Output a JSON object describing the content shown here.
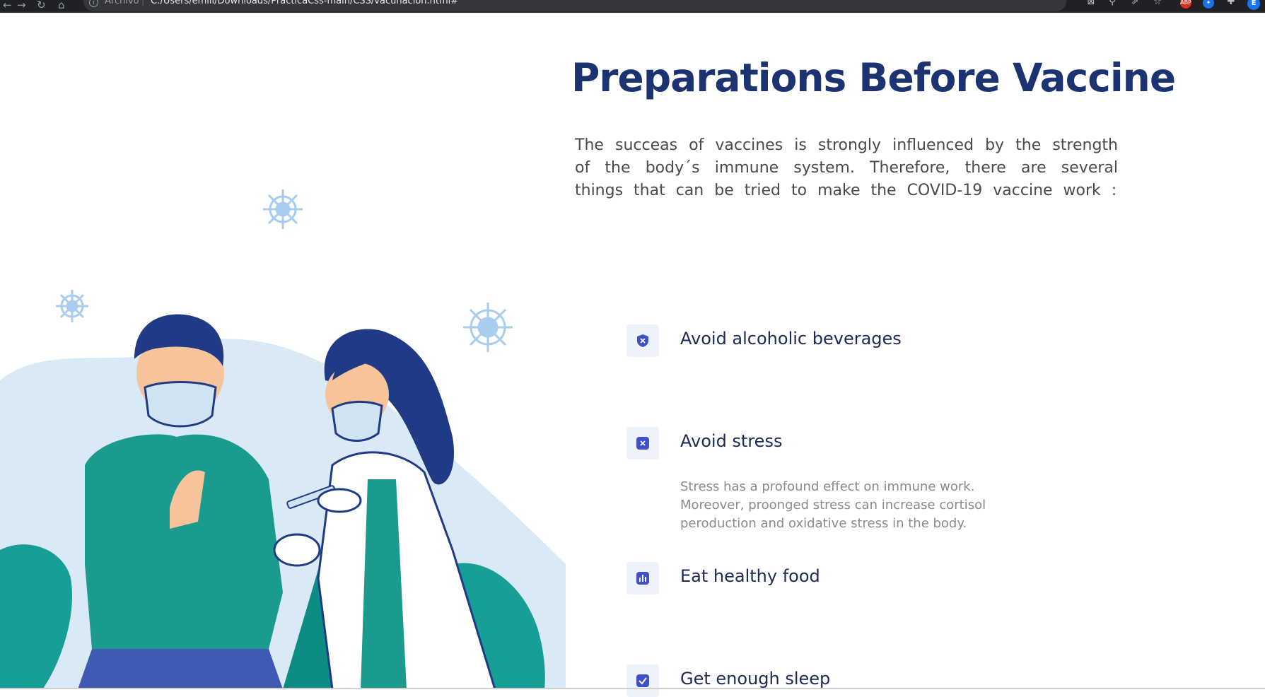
{
  "browser": {
    "secure_label": "Archivo",
    "separator": "|",
    "url": "C:/Users/emili/Downloads/PracticaCss-main/CSS/vacunacion.html#",
    "profile_initial": "E",
    "ext_label": "ABP"
  },
  "page": {
    "title": "Preparations Before Vaccine",
    "intro": "The succeas of vaccines is strongly influenced by the strength of the body´s immune system. Therefore, there are several things that can be tried to make the COVID-19 vaccine work :",
    "accent_color": "#1b3471",
    "items": [
      {
        "icon": "shield-icon",
        "title": "Avoid alcoholic beverages",
        "description": ""
      },
      {
        "icon": "x-square-icon",
        "title": "Avoid stress",
        "description": "Stress has a profound effect on immune work. Moreover, proonged stress can increase cortisol peroduction and oxidative stress in the body."
      },
      {
        "icon": "bar-chart-icon",
        "title": "Eat healthy food",
        "description": ""
      },
      {
        "icon": "check-square-icon",
        "title": "Get enough sleep",
        "description": ""
      }
    ]
  }
}
